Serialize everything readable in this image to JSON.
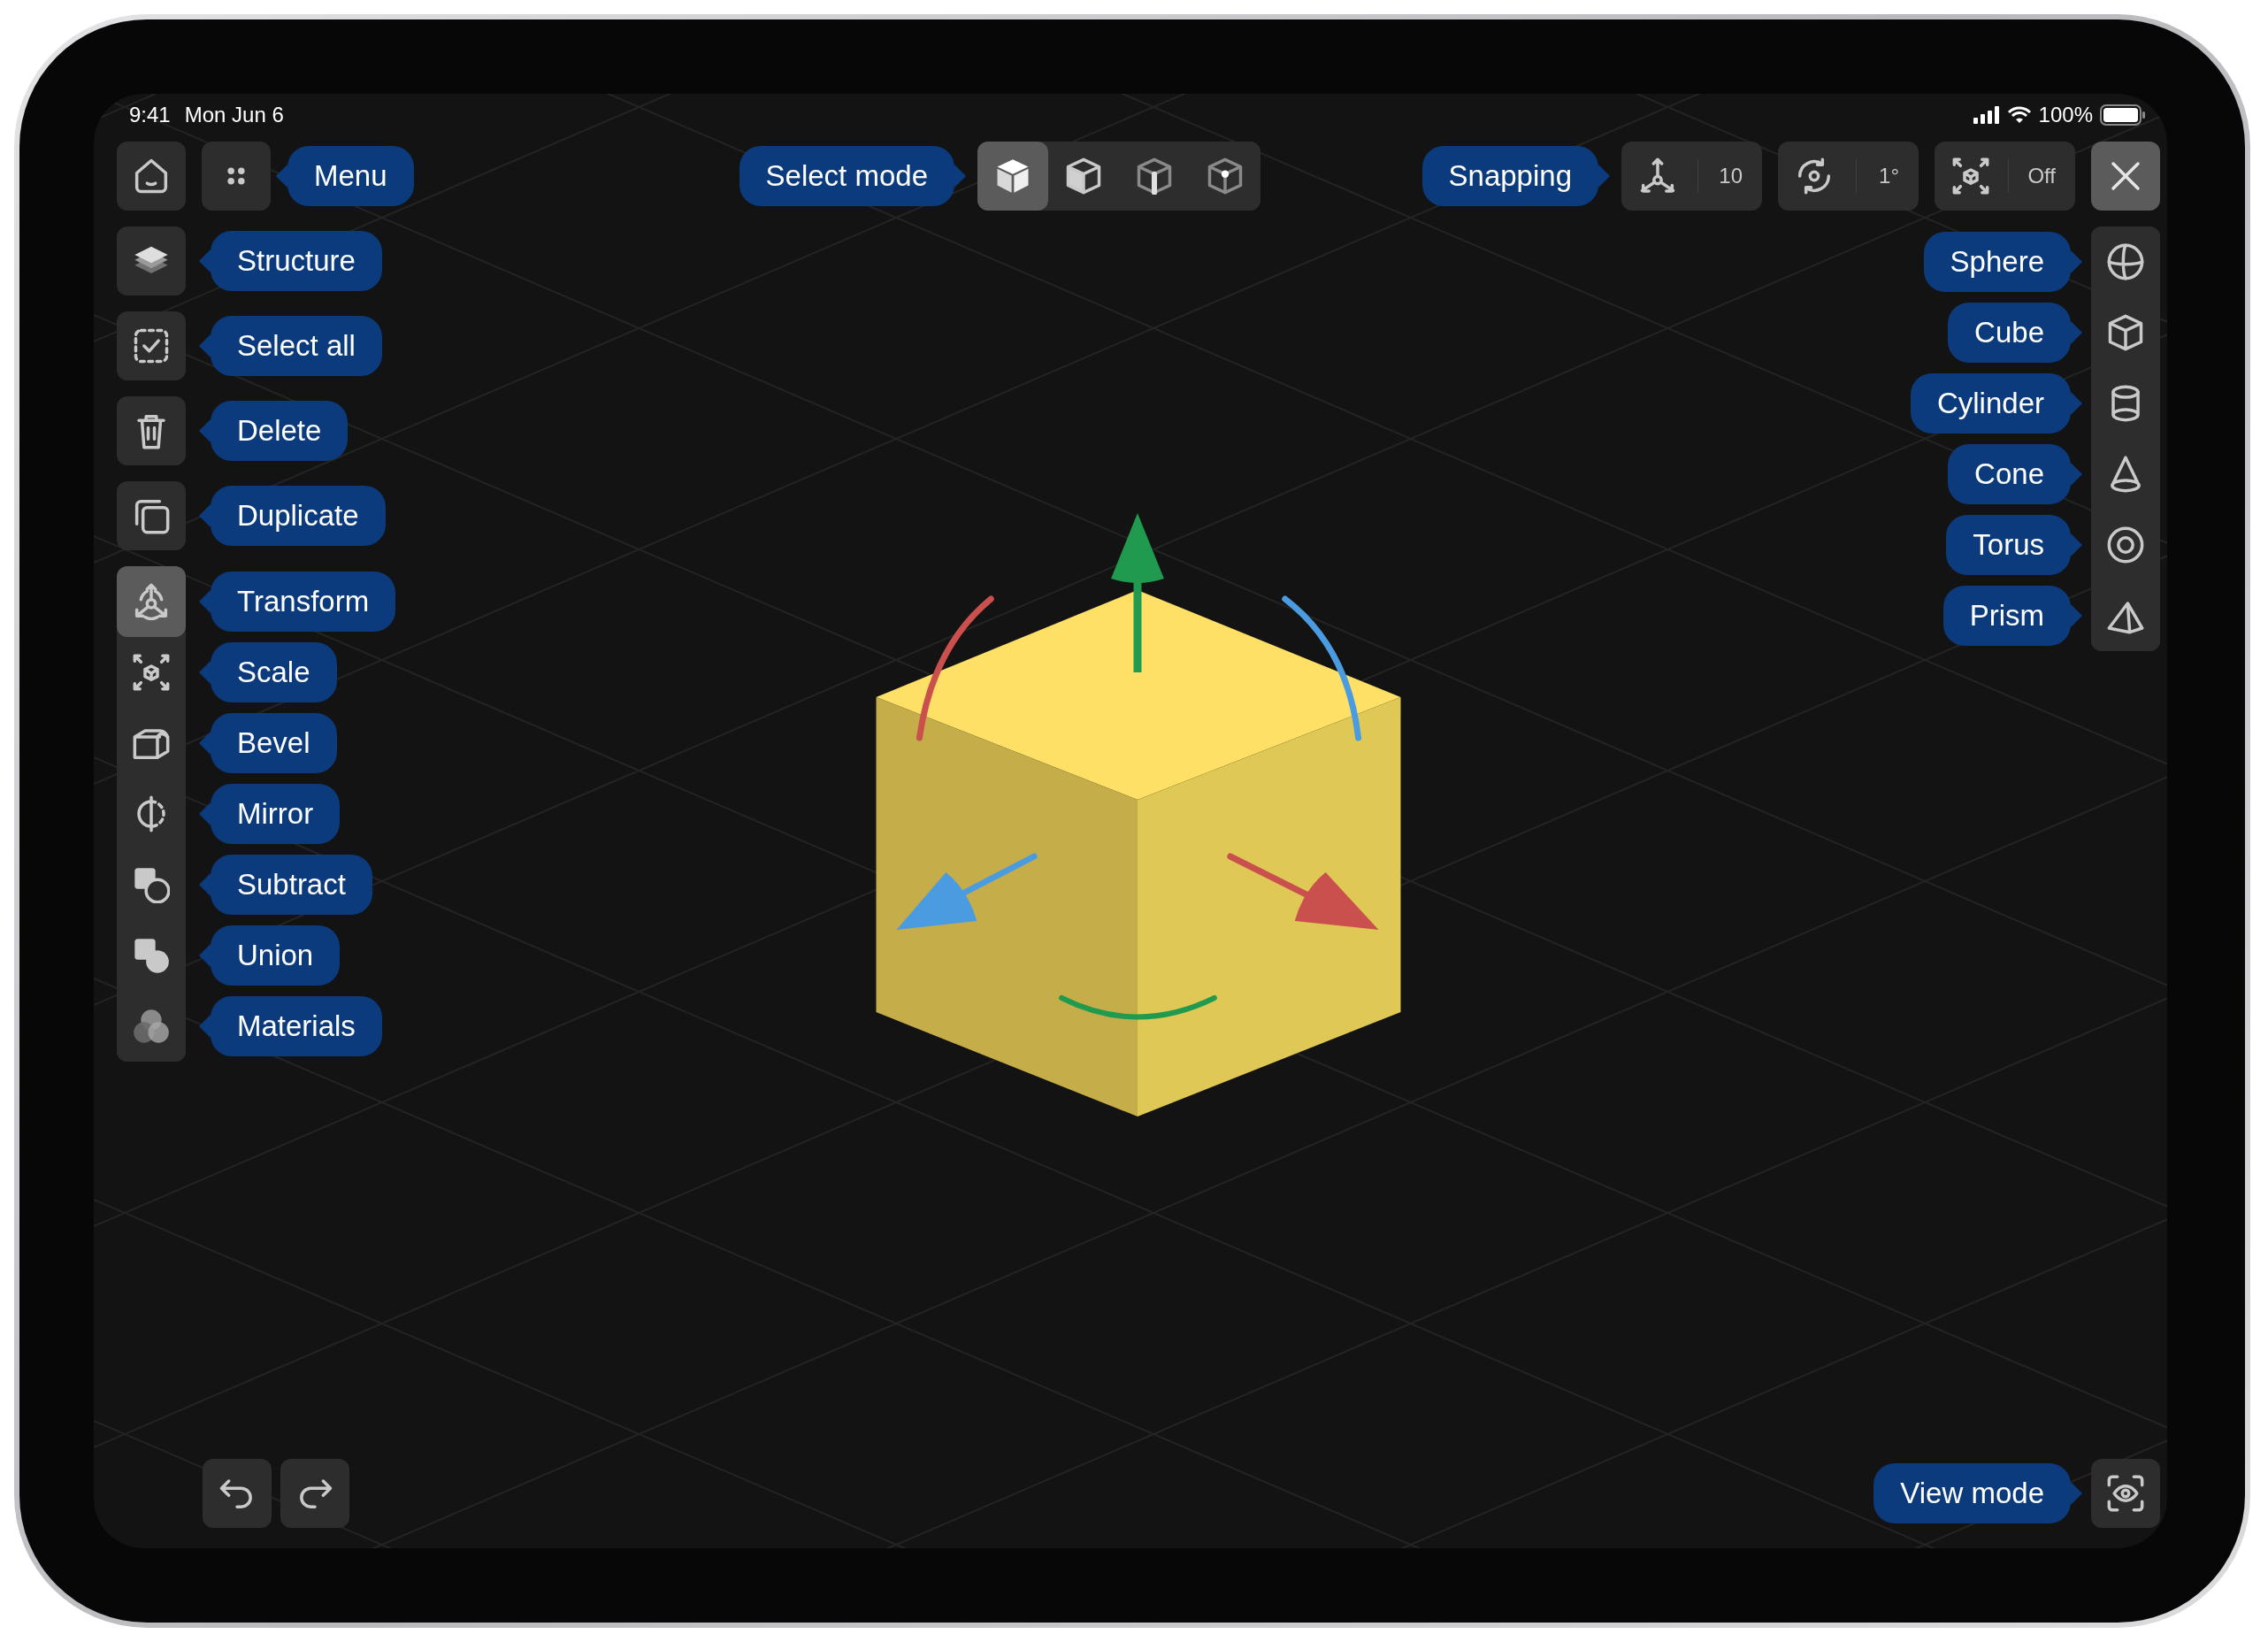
{
  "status_bar": {
    "time": "9:41",
    "date": "Mon Jun 6",
    "battery": "100%"
  },
  "toolbar": {
    "menu_tooltip": "Menu",
    "select_mode": {
      "tooltip": "Select mode",
      "modes": [
        {
          "kind": "object",
          "selected": true
        },
        {
          "kind": "face",
          "selected": false
        },
        {
          "kind": "edge",
          "selected": false
        },
        {
          "kind": "vertex",
          "selected": false
        }
      ]
    },
    "snapping": {
      "tooltip": "Snapping",
      "options": [
        {
          "kind": "move",
          "value": "10"
        },
        {
          "kind": "rotate",
          "value": "1°"
        },
        {
          "kind": "scale",
          "value": "Off"
        }
      ]
    }
  },
  "actions": [
    {
      "kind": "structure",
      "label": "Structure"
    },
    {
      "kind": "select_all",
      "label": "Select all"
    },
    {
      "kind": "delete",
      "label": "Delete"
    },
    {
      "kind": "duplicate",
      "label": "Duplicate"
    }
  ],
  "tools": [
    {
      "kind": "transform",
      "label": "Transform",
      "selected": true
    },
    {
      "kind": "scale",
      "label": "Scale",
      "selected": false
    },
    {
      "kind": "bevel",
      "label": "Bevel",
      "selected": false
    },
    {
      "kind": "mirror",
      "label": "Mirror",
      "selected": false
    },
    {
      "kind": "subtract",
      "label": "Subtract",
      "selected": false
    },
    {
      "kind": "union",
      "label": "Union",
      "selected": false
    },
    {
      "kind": "materials",
      "label": "Materials",
      "selected": false
    }
  ],
  "primitives": [
    {
      "kind": "sphere",
      "label": "Sphere"
    },
    {
      "kind": "cube",
      "label": "Cube"
    },
    {
      "kind": "cylinder",
      "label": "Cylinder"
    },
    {
      "kind": "cone",
      "label": "Cone"
    },
    {
      "kind": "torus",
      "label": "Torus"
    },
    {
      "kind": "prism",
      "label": "Prism"
    }
  ],
  "view_mode": {
    "tooltip": "View mode"
  }
}
